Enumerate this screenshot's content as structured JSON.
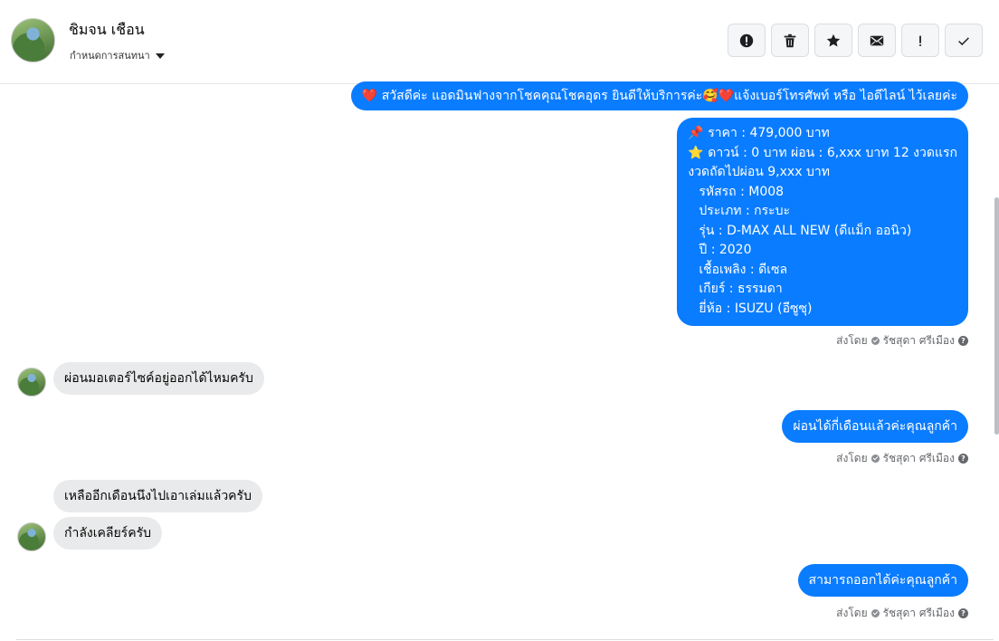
{
  "header": {
    "contact_name": "ชิมจน เชือน",
    "conversation_settings": "กำหนดการสนทนา"
  },
  "actions": [
    {
      "name": "spam-button",
      "icon": "alert-circle-icon"
    },
    {
      "name": "delete-button",
      "icon": "trash-icon"
    },
    {
      "name": "star-button",
      "icon": "star-icon"
    },
    {
      "name": "mark-unread-button",
      "icon": "envelope-icon"
    },
    {
      "name": "follow-up-button",
      "icon": "exclamation-icon"
    },
    {
      "name": "mark-done-button",
      "icon": "checkmark-icon"
    }
  ],
  "messages": {
    "m1": "❤️ สวัสดีค่ะ แอดมินฟางจากโชคคุณโชคอุดร ยินดีให้บริการค่ะ🥰❤️แจ้งเบอร์โทรศัพท์ หรือ ไอดีไลน์  ไว้เลยค่ะ",
    "m2_lines": [
      "📌 ราคา : 479,000 บาท",
      "⭐ ดาวน์ : 0 บาท ผ่อน : 6,xxx บาท 12 งวดแรก",
      "งวดถัดไปผ่อน  9,xxx บาท",
      "รหัสรถ : M008",
      "ประเภท : กระบะ",
      "รุ่น : D-MAX ALL NEW (ดีแม็ก ออนิว)",
      "ปี : 2020",
      "เชื้อเพลิง : ดีเซล",
      "เกียร์ : ธรรมดา",
      "ยี่ห้อ : ISUZU (อีซูซุ)"
    ],
    "m3": "ผ่อนมอเตอร์ไซค์อยู่ออกได้ไหมครับ",
    "m4": "ผ่อนได้กี่เดือนแล้วค่ะคุณลูกค้า",
    "m5": "เหลืออีกเดือนนึงไปเอาเล่มแล้วครับ",
    "m6": "กำลังเคลียร์ครับ",
    "m7": "สามารถออกได้ค่ะคุณลูกค้า"
  },
  "sent_by": {
    "prefix": "ส่งโดย",
    "agent": "รัชสุดา ศรีเมือง"
  },
  "colors": {
    "outgoing_bubble": "#0a7cff",
    "incoming_bubble": "#e9eaeb"
  }
}
